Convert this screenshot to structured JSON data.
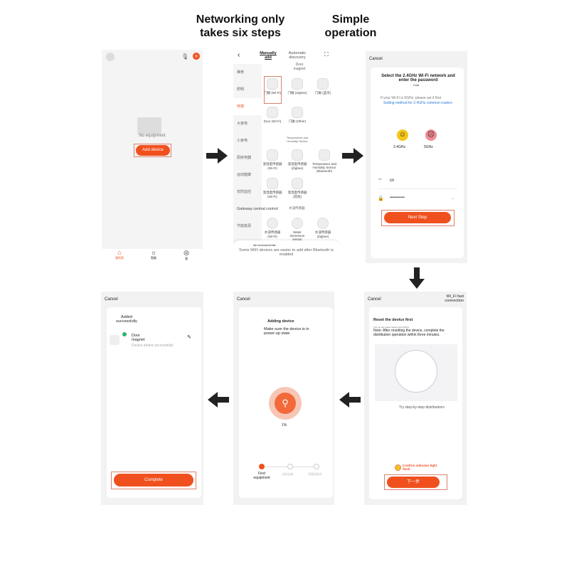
{
  "headers": {
    "left": "Networking only takes six steps",
    "right": "Simple operation"
  },
  "colors": {
    "accent": "#f0501e",
    "link": "#2b7bd6",
    "success": "#2db36f"
  },
  "panel1": {
    "empty_text": "No equipment",
    "add_button": "Add device",
    "tabs": [
      {
        "label": "我的家",
        "icon": "home-icon"
      },
      {
        "label": "智能",
        "icon": "gear-icon"
      },
      {
        "label": "我",
        "icon": "user-icon"
      }
    ]
  },
  "panel2": {
    "tabs": [
      "Manually add",
      "Automatic discovery"
    ],
    "sidebar": [
      "推荐",
      "照明",
      "传感",
      "大家电",
      "小家电",
      "厨房电器",
      "运动健康",
      "安防监控",
      "Gateway central control",
      "节能能源"
    ],
    "section_door": "Door magnet",
    "door_devices": [
      "门磁 (Wi-Fi)",
      "门磁 (Zigbee)",
      "门磁 (蓝牙)",
      "Door (Wi-Fi)",
      "门磁 (Other)"
    ],
    "section_temp": "Temperature and Humidity Sensor",
    "temp_devices": [
      "温湿度传感器 (Wi-Fi)",
      "温湿度传感器 (Zigbee)",
      "Temperature and Humidity Sensor (Bluetooth)",
      "温湿度传感器 (Wi-Fi)",
      "温湿度传感器 (其他)"
    ],
    "section_water": "水浸传感器",
    "water_devices": [
      "水浸传感器 (Wi-Fi)",
      "Water immersion sensor",
      "水浸传感器 (Zigbee)"
    ],
    "toast_small": "We recommend that",
    "toast": "Some WiFi devices are easier to add after Bluetooth is enabled"
  },
  "panel3": {
    "cancel": "Cancel",
    "title": "Select the 2.4GHz Wi-Fi network and enter the password",
    "code": "Code",
    "hint": "If your Wi-Fi is 5GHz, please set it first",
    "link": "Setting method for 2.4GHz common routers",
    "band_ok": "2.4GHz",
    "band_bad": "5GHz",
    "ssid": "cn",
    "password": "••••••••••••",
    "next": "Next Step"
  },
  "panel4": {
    "cancel": "Cancel",
    "mode": "Wi_Fi fast connection",
    "title": "Reset the device first",
    "small": "Turn on the power supply and confirm",
    "note": "Note: After resetting the device, complete the distribution operation within three minutes.",
    "link": "Try step-by-step distribution>",
    "confirm": "Confirm indicator light flash",
    "next": "下一步"
  },
  "panel5": {
    "cancel": "Cancel",
    "title": "Adding device",
    "subtitle": "Make sure the device is in power-up state",
    "progress": "1%",
    "progress_value": 1,
    "steps": [
      "Find equipment",
      "注册云端",
      "设备初始化"
    ]
  },
  "panel6": {
    "cancel": "Cancel",
    "title": "Added successfully",
    "device": "Door magnet",
    "status": "Device added successfully",
    "complete": "Complete"
  }
}
